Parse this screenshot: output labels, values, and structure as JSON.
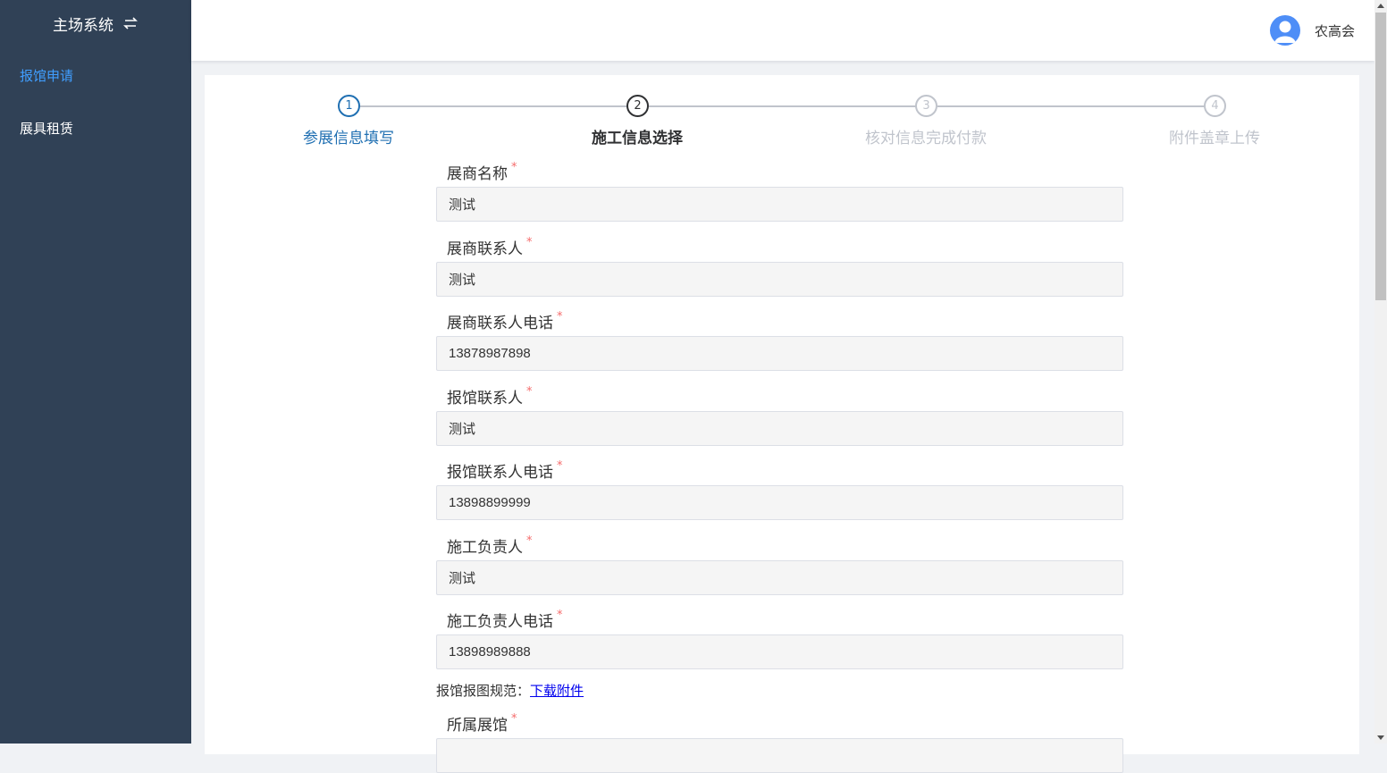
{
  "sidebar": {
    "brand": "主场系统",
    "items": [
      {
        "label": "报馆申请",
        "active": true
      },
      {
        "label": "展具租赁",
        "active": false
      }
    ]
  },
  "header": {
    "username": "农高会"
  },
  "steps": [
    {
      "number": "1",
      "title": "参展信息填写",
      "status": "finish"
    },
    {
      "number": "2",
      "title": "施工信息选择",
      "status": "process"
    },
    {
      "number": "3",
      "title": "核对信息完成付款",
      "status": "wait"
    },
    {
      "number": "4",
      "title": "附件盖章上传",
      "status": "wait"
    }
  ],
  "form": {
    "fields": [
      {
        "label": "展商名称",
        "value": "测试"
      },
      {
        "label": "展商联系人",
        "value": "测试"
      },
      {
        "label": "展商联系人电话",
        "value": "13878987898"
      },
      {
        "label": "报馆联系人",
        "value": "测试"
      },
      {
        "label": "报馆联系人电话",
        "value": "13898899999"
      },
      {
        "label": "施工负责人",
        "value": "测试"
      },
      {
        "label": "施工负责人电话",
        "value": "13898989888"
      }
    ],
    "required_mark": "*",
    "download_prefix": "报馆报图规范：",
    "download_link": "下载附件",
    "hall_label": "所属展馆"
  },
  "colors": {
    "sidebar_bg": "#304156",
    "active_menu": "#409eff",
    "step_finish": "#1f6fb2",
    "required": "#f56c6c"
  }
}
